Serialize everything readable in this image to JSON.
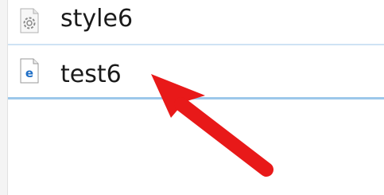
{
  "file_list": {
    "items": [
      {
        "name": "style6",
        "icon": "settings-file-icon"
      },
      {
        "name": "test6",
        "icon": "edge-html-file-icon"
      }
    ],
    "selected_item": "test6"
  },
  "annotation": {
    "type": "arrow",
    "color": "#e81919",
    "points_to": "test6"
  },
  "colors": {
    "selection_border": "#9cc8ea",
    "row_divider": "#cfe3f4",
    "edge_blue": "#1f6fc7"
  }
}
